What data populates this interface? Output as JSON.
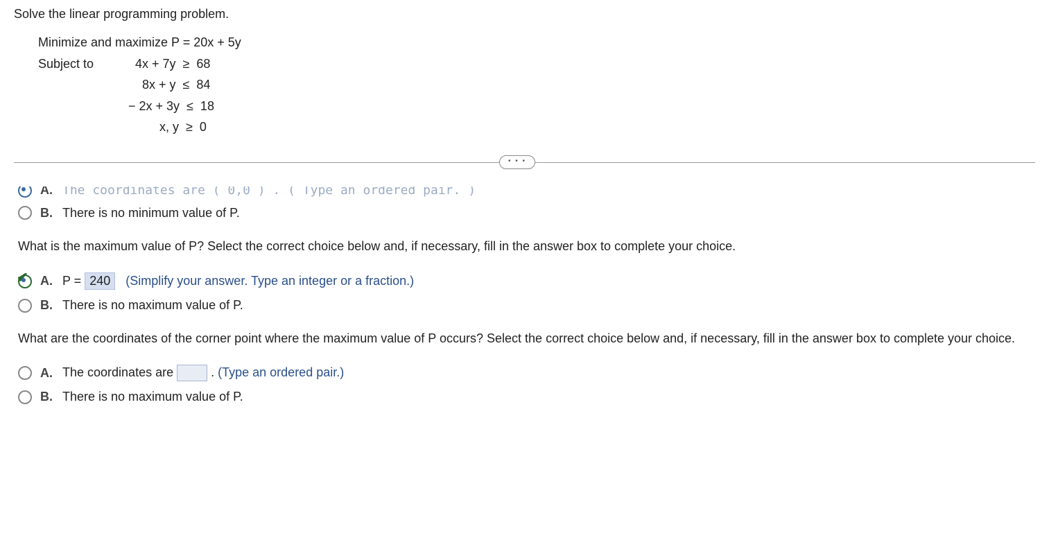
{
  "problem": {
    "instruction": "Solve the linear programming problem.",
    "objective": "Minimize and maximize P = 20x + 5y",
    "subject_label": "Subject to",
    "constraints": [
      "  4x + 7y  ≥  68",
      "    8x + y  ≤  84",
      "− 2x + 3y  ≤  18",
      "         x, y  ≥  0"
    ]
  },
  "divider_dots": "• • •",
  "section1": {
    "optA_partial": "The coordinates are  ( 0,0 ) . ( Type an ordered pair. )",
    "optA_letter": "A.",
    "optB_letter": "B.",
    "optB_text": "There is no minimum value of P."
  },
  "section2": {
    "question": "What is the maximum value of P? Select the correct choice below and, if necessary, fill in the answer box to complete your choice.",
    "optA_letter": "A.",
    "optA_prefix": "P = ",
    "optA_value": "240",
    "optA_hint": "(Simplify your answer. Type an integer or a fraction.)",
    "optB_letter": "B.",
    "optB_text": "There is no maximum value of P."
  },
  "section3": {
    "question": "What are the coordinates of the corner point where the maximum value of P occurs? Select the correct choice below and, if necessary, fill in the answer box to complete your choice.",
    "optA_letter": "A.",
    "optA_prefix": "The coordinates are ",
    "optA_suffix": ". ",
    "optA_hint": "(Type an ordered pair.)",
    "optB_letter": "B.",
    "optB_text": "There is no maximum value of P."
  }
}
